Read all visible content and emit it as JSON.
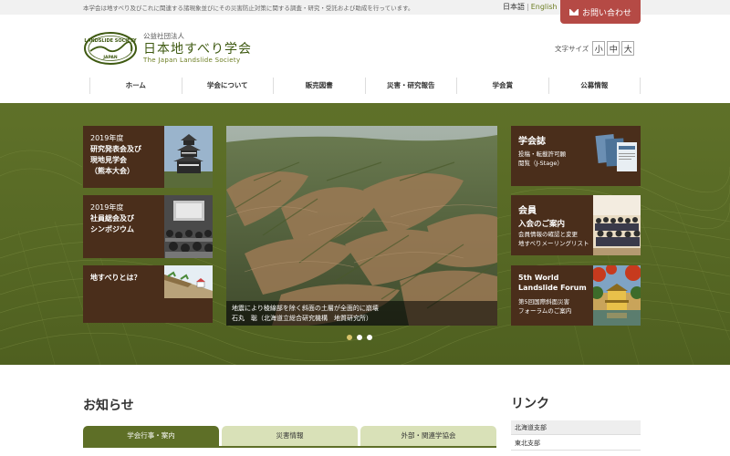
{
  "header": {
    "tagline": "本学会は地すべり及びこれに関連する諸現象並びにその災害防止対策に関する調査・研究・受託および助成を行っています。",
    "lang_ja": "日本語",
    "lang_sep": "|",
    "lang_en": "English",
    "contact_label": "お問い合わせ",
    "logo_emblem_text": "LANDSLIDE SOCIETY",
    "logo_emblem_sub": "JAPAN",
    "org_type": "公益社団法人",
    "org_name": "日本地すべり学会",
    "org_name_en": "The Japan Landslide Society",
    "text_size_label": "文字サイズ",
    "text_sizes": [
      "小",
      "中",
      "大"
    ]
  },
  "nav": {
    "items": [
      "ホーム",
      "学会について",
      "販売図書",
      "災害・研究報告",
      "学会賞",
      "公募情報"
    ]
  },
  "hero": {
    "left_tiles": [
      {
        "line1": "2019年度",
        "line2": "研究発表会及び",
        "line3": "現地見学会",
        "line4": "（熊本大会）"
      },
      {
        "line1": "2019年度",
        "line2": "社員総会及び",
        "line3": "シンポジウム"
      },
      {
        "line1": "地すべりとは？"
      }
    ],
    "caption_line1": "地震により稜線部を除く斜面の土層が全面的に崩壊",
    "caption_line2": "石丸　聡（北海道立総合研究機構　地質研究所）",
    "right_tiles": [
      {
        "title": "学会誌",
        "sub1": "投稿・転載許可願",
        "sub2": "閲覧（J-Stage）"
      },
      {
        "title": "会員",
        "title2": "入会のご案内",
        "sub1": "会員情報の確認と変更",
        "sub2": "地すべりメーリングリスト"
      },
      {
        "title": "5th World",
        "title2": "Landslide Forum",
        "sub1": "第5回国際斜面災害",
        "sub2": "フォーラムのご案内"
      }
    ]
  },
  "news": {
    "title": "お知らせ",
    "tabs": [
      "学会行事・案内",
      "災害情報",
      "外部・関連学協会"
    ]
  },
  "links": {
    "title": "リンク",
    "items": [
      "北海道支部",
      "東北支部"
    ]
  }
}
